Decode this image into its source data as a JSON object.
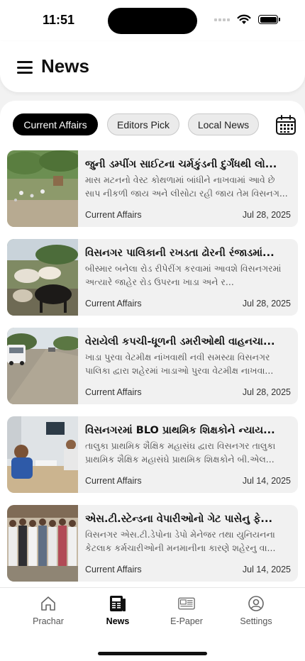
{
  "status_bar": {
    "time": "11:51"
  },
  "header": {
    "title": "News"
  },
  "chips": [
    {
      "label": "Current Affairs",
      "active": true
    },
    {
      "label": "Editors Pick",
      "active": false
    },
    {
      "label": "Local News",
      "active": false
    }
  ],
  "news": [
    {
      "title": "જુની ડમ્પીંગ સાઈટના ચર્મકુંડની દુર્ગંધથી લો...",
      "desc": "માસ મટનનો વેસ્ટ કોથળામાં બાંધીને નાખવામાં આવે છે સાપ નીકળી જાય અને લીસોટા રહી જાય તેમ વિસનગ...",
      "category": "Current Affairs",
      "date": "Jul 28, 2025"
    },
    {
      "title": "વિસનગર પાલિકાની રખડતા ઢોરની રંજાડમાં...",
      "desc": "બીસ્માર બનેલા રોડ રીપેરીંગ કરવામાં આવશે વિસનગરમાં અત્યારે જાહેર રોડ ઉપરના ખાડા અને ર...",
      "category": "Current Affairs",
      "date": "Jul 28, 2025"
    },
    {
      "title": "વેરાયેલી કપચી-ધૂળની ડમરીઓથી વાહનચા...",
      "desc": "ખાડા પુરવા વેટમીક્ષ નાંખવાથી નવી સમસ્યા વિસનગર પાલિકા દ્વારા શહેરમાં ખાડાઓ પુરવા વેટમીક્ષ નાખવા...",
      "category": "Current Affairs",
      "date": "Jul 28, 2025"
    },
    {
      "title": "વિસનગરમાં BLO પ્રાથમિક શિક્ષકોને ન્યાય...",
      "desc": "તાલુકા પ્રાથમિક શૈક્ષિક મહાસંઘ દ્વારા વિસનગર તાલુકા પ્રાથમિક શૈક્ષિક મહાસંઘે પ્રાથમિક શિક્ષકોને બી.એલ...",
      "category": "Current Affairs",
      "date": "Jul 14, 2025"
    },
    {
      "title": "એસ.ટી.સ્ટેન્ડના વેપારીઓનો ગેટ પાસેનુ ફે...",
      "desc": "વિસનગર એસ.ટી.ડેપોના ડેપો મેનેજર તથા યુનિયનના કેટલાક કર્મચારીઓની મનમાનીના કારણે શહેરનુ વા...",
      "category": "Current Affairs",
      "date": "Jul 14, 2025"
    }
  ],
  "tabs": [
    {
      "label": "Prachar",
      "icon": "home-icon",
      "active": false
    },
    {
      "label": "News",
      "icon": "newspaper-icon",
      "active": true
    },
    {
      "label": "E-Paper",
      "icon": "epaper-icon",
      "active": false
    },
    {
      "label": "Settings",
      "icon": "user-circle-icon",
      "active": false
    }
  ]
}
